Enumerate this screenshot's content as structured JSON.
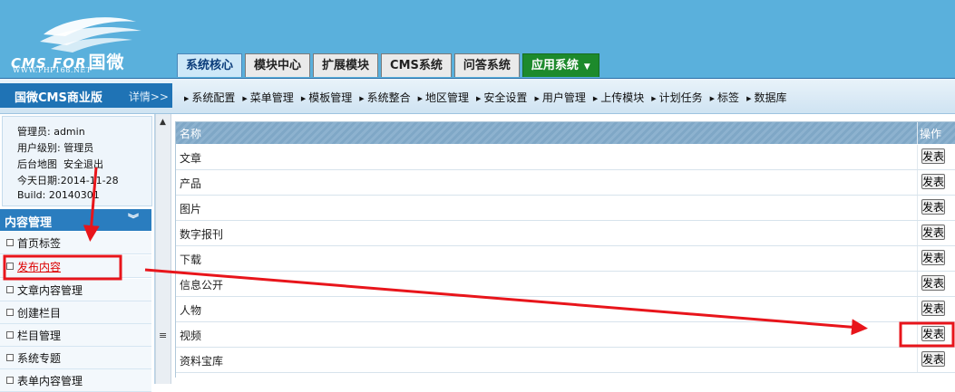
{
  "logo": {
    "text": "CMS FOR",
    "cn": "国微",
    "url": "WWW.PHP168.NET"
  },
  "main_tabs": [
    {
      "label": "系统核心"
    },
    {
      "label": "模块中心"
    },
    {
      "label": "扩展模块"
    },
    {
      "label": "CMS系统"
    },
    {
      "label": "问答系统"
    },
    {
      "label": "应用系统"
    }
  ],
  "brand": {
    "title": "国微CMS商业版",
    "more": "详情>>"
  },
  "subnav": [
    "系统配置",
    "菜单管理",
    "模板管理",
    "系统整合",
    "地区管理",
    "安全设置",
    "用户管理",
    "上传模块",
    "计划任务",
    "标签",
    "数据库"
  ],
  "userinfo": {
    "admin_line": "管理员: admin",
    "level_line": "用户级别: 管理员",
    "sitemap": "后台地图",
    "logout": "安全退出",
    "date_line": "今天日期:2014-11-28",
    "build_line": "Build: 20140301"
  },
  "sidebar": {
    "section_title": "内容管理",
    "section_chevron": "︾",
    "items": [
      {
        "label": "首页标签"
      },
      {
        "label": "发布内容"
      },
      {
        "label": "文章内容管理"
      },
      {
        "label": "创建栏目"
      },
      {
        "label": "栏目管理"
      },
      {
        "label": "系统专题"
      },
      {
        "label": "表单内容管理"
      }
    ]
  },
  "table": {
    "col_name": "名称",
    "col_action": "操作",
    "rows": [
      {
        "name": "文章",
        "action": "发表"
      },
      {
        "name": "产品",
        "action": "发表"
      },
      {
        "name": "图片",
        "action": "发表"
      },
      {
        "name": "数字报刊",
        "action": "发表"
      },
      {
        "name": "下载",
        "action": "发表"
      },
      {
        "name": "信息公开",
        "action": "发表"
      },
      {
        "name": "人物",
        "action": "发表"
      },
      {
        "name": "视频",
        "action": "发表"
      },
      {
        "name": "资料宝库",
        "action": "发表"
      }
    ]
  },
  "colors": {
    "header_bg": "#5ab0dc",
    "annotation_red": "#e8151b",
    "app_tab": "#1d8a2c"
  }
}
